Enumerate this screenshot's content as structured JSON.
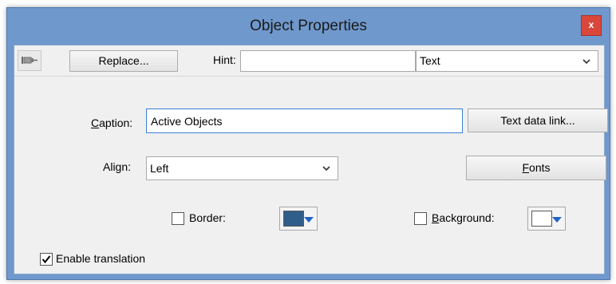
{
  "window": {
    "title": "Object Properties",
    "close_label": "x"
  },
  "toolbar": {
    "pin_icon": "pin-icon",
    "replace_label": "Replace...",
    "hint_label": "Hint:",
    "hint_value": "",
    "type_selected": "Text"
  },
  "caption": {
    "label_prefix": "",
    "label_accel": "C",
    "label_rest": "aption:",
    "value": "Active Objects",
    "text_data_link_label": "Text data link..."
  },
  "align": {
    "label": "Align:",
    "selected": "Left",
    "fonts_accel": "F",
    "fonts_rest": "onts"
  },
  "border": {
    "label": "Border:",
    "checked": false,
    "color": "#2f5e8a"
  },
  "background": {
    "label_accel": "B",
    "label_rest": "ackground:",
    "checked": false,
    "color": "#ffffff"
  },
  "translation": {
    "label": "Enable translation",
    "checked": true
  }
}
